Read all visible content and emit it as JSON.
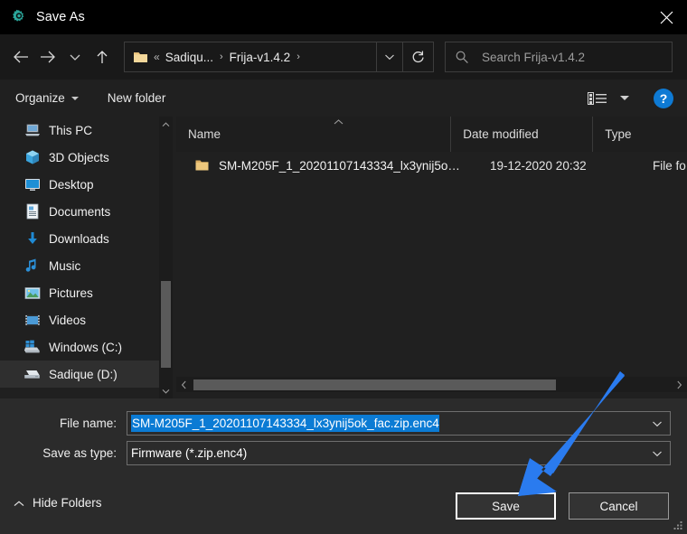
{
  "window": {
    "title": "Save As",
    "title_icon": "gear-icon",
    "close_icon": "close-icon",
    "accent_blue": "#0b7bd4",
    "annotation_arrow_color": "#2a7bef",
    "titlebar_bg": "#000000",
    "dialog_bg": "#2b2b2b"
  },
  "nav": {
    "back_icon": "arrow-left-icon",
    "forward_icon": "arrow-right-icon",
    "recent_icon": "chevron-down-icon",
    "up_icon": "arrow-up-icon",
    "refresh_icon": "refresh-icon",
    "breadcrumb": {
      "folder_icon": "folder-icon",
      "overflow": "«",
      "items": [
        "Sadiqu...",
        "Frija-v1.4.2"
      ],
      "separator": "›",
      "dropdown_icon": "chevron-down-icon"
    },
    "search": {
      "icon": "search-icon",
      "placeholder": "Search Frija-v1.4.2",
      "value": ""
    }
  },
  "toolbar": {
    "organize_label": "Organize",
    "organize_caret_icon": "caret-down-icon",
    "new_folder_label": "New folder",
    "view_icon": "details-view-icon",
    "view_caret_icon": "caret-down-icon",
    "help_icon": "help-icon",
    "help_label": "?"
  },
  "sidebar": {
    "scrollbar": {
      "up_icon": "chevron-up-icon",
      "down_icon": "chevron-down-icon"
    },
    "items": [
      {
        "label": "This PC",
        "icon": "computer-icon",
        "selected": false
      },
      {
        "label": "3D Objects",
        "icon": "3d-objects-icon",
        "selected": false
      },
      {
        "label": "Desktop",
        "icon": "desktop-icon",
        "selected": false
      },
      {
        "label": "Documents",
        "icon": "documents-icon",
        "selected": false
      },
      {
        "label": "Downloads",
        "icon": "downloads-icon",
        "selected": false
      },
      {
        "label": "Music",
        "icon": "music-icon",
        "selected": false
      },
      {
        "label": "Pictures",
        "icon": "pictures-icon",
        "selected": false
      },
      {
        "label": "Videos",
        "icon": "videos-icon",
        "selected": false
      },
      {
        "label": "Windows (C:)",
        "icon": "windows-drive-icon",
        "selected": false
      },
      {
        "label": "Sadique (D:)",
        "icon": "drive-icon",
        "selected": true
      }
    ]
  },
  "filelist": {
    "columns": [
      {
        "label": "Name",
        "sorted": "ascending",
        "sort_icon": "chevron-up-icon"
      },
      {
        "label": "Date modified",
        "sorted": "",
        "sort_icon": ""
      },
      {
        "label": "Type",
        "sorted": "",
        "sort_icon": ""
      }
    ],
    "rows": [
      {
        "icon": "folder-icon",
        "name": "SM-M205F_1_20201107143334_lx3ynij5o…",
        "date_modified": "19-12-2020 20:32",
        "type": "File fo"
      }
    ],
    "hscrollbar": {
      "left_icon": "chevron-left-icon",
      "right_icon": "chevron-right-icon"
    }
  },
  "form": {
    "filename": {
      "label": "File name:",
      "value": "SM-M205F_1_20201107143334_lx3ynij5ok_fac.zip.enc4",
      "selected": true,
      "caret_icon": "chevron-down-icon"
    },
    "savetype": {
      "label": "Save as type:",
      "value": "Firmware (*.zip.enc4)",
      "caret_icon": "chevron-down-icon"
    }
  },
  "footer": {
    "hide_folders_label": "Hide Folders",
    "hide_folders_icon": "chevron-up-icon",
    "save_label": "Save",
    "cancel_label": "Cancel",
    "resize_grip_icon": "resize-grip-icon"
  }
}
